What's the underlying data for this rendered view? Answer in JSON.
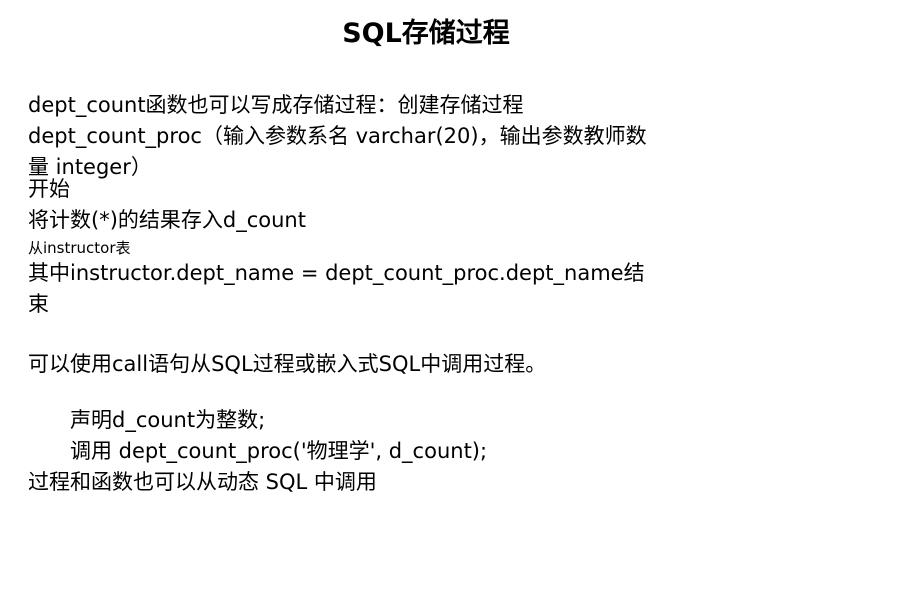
{
  "slide": {
    "title": "SQL存储过程",
    "lines": [
      "dept_count函数也可以写成存储过程：创建存储过程",
      "dept_count_proc（输入参数系名 varchar(20)，输出参数教师数",
      "量 integer）",
      "开始",
      "将计数(*)的结果存入d_count",
      "从instructor表",
      "其中instructor.dept_name = dept_count_proc.dept_name结",
      "束",
      "可以使用call语句从SQL过程或嵌入式SQL中调用过程。",
      "声明d_count为整数;",
      "调用 dept_count_proc('物理学', d_count);",
      "过程和函数也可以从动态 SQL 中调用"
    ]
  }
}
